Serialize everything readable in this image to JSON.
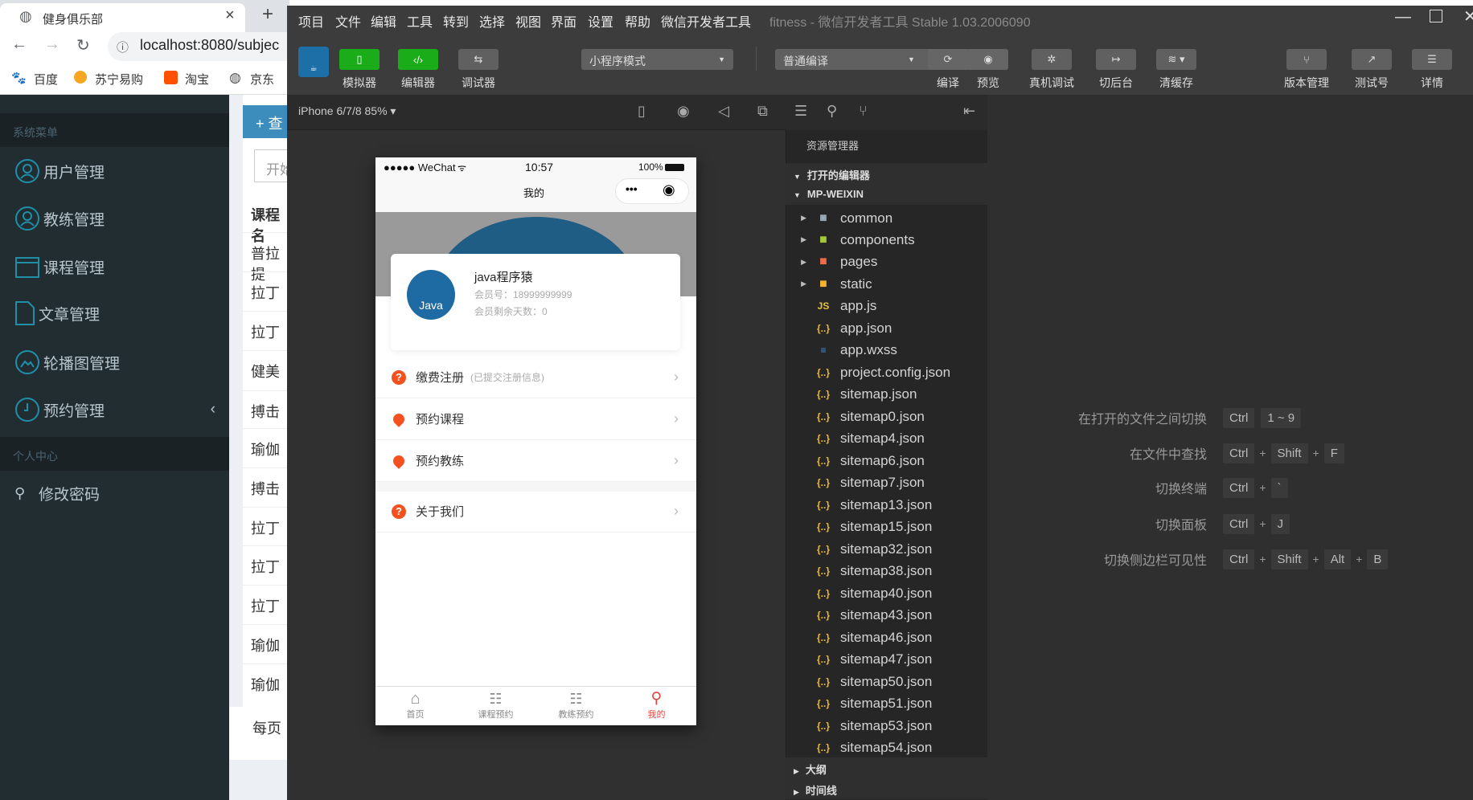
{
  "browser": {
    "tab_title": "健身俱乐部",
    "tab_close": "×",
    "new_tab": "+",
    "url": "localhost:8080/subjec",
    "bookmarks": [
      "百度",
      "苏宁易购",
      "淘宝",
      "京东"
    ]
  },
  "admin": {
    "section_system": "系统菜单",
    "menu": [
      "用户管理",
      "教练管理",
      "课程管理",
      "文章管理",
      "轮播图管理",
      "预约管理"
    ],
    "section_personal": "个人中心",
    "change_password": "修改密码",
    "add_button": "+ 查",
    "date_placeholder": "开始",
    "column_header": "课程名",
    "rows": [
      "普拉提",
      "拉丁",
      "拉丁",
      "健美",
      "搏击",
      "瑜伽",
      "搏击",
      "拉丁",
      "拉丁",
      "拉丁",
      "瑜伽",
      "瑜伽"
    ],
    "per_page": "每页"
  },
  "devtools": {
    "menu": [
      "项目",
      "文件",
      "编辑",
      "工具",
      "转到",
      "选择",
      "视图",
      "界面",
      "设置",
      "帮助",
      "微信开发者工具"
    ],
    "window_title": "fitness - 微信开发者工具 Stable 1.03.2006090",
    "toolbar": {
      "simulator": "模拟器",
      "editor": "编辑器",
      "debugger": "调试器",
      "mode": "小程序模式",
      "compile_mode": "普通编译",
      "compile": "编译",
      "preview": "预览",
      "remote_debug": "真机调试",
      "background": "切后台",
      "clear_cache": "清缓存",
      "version": "版本管理",
      "test_account": "测试号",
      "details": "详情"
    },
    "device": "iPhone 6/7/8 85% ▾"
  },
  "phone": {
    "signal": "●●●●● WeChat",
    "time": "10:57",
    "battery": "100%",
    "nav_title": "我的",
    "user_name": "java程序猿",
    "member_no": "会员号：18999999999",
    "days_left": "会员剩余天数：0",
    "avatar_text": "Java",
    "menu": [
      {
        "label": "缴费注册",
        "note": "(已提交注册信息)",
        "icon": "question"
      },
      {
        "label": "预约课程",
        "note": "",
        "icon": "pin"
      },
      {
        "label": "预约教练",
        "note": "",
        "icon": "pin"
      },
      {
        "label": "关于我们",
        "note": "",
        "icon": "question"
      }
    ],
    "tabs": [
      "首页",
      "课程预约",
      "教练预约",
      "我的"
    ],
    "active_tab_color": "#e64340"
  },
  "explorer": {
    "title": "资源管理器",
    "open_editors": "打开的编辑器",
    "root": "MP-WEIXIN",
    "folders": [
      "common",
      "components",
      "pages",
      "static"
    ],
    "files": [
      "app.js",
      "app.json",
      "app.wxss",
      "project.config.json",
      "sitemap.json",
      "sitemap0.json",
      "sitemap4.json",
      "sitemap6.json",
      "sitemap7.json",
      "sitemap13.json",
      "sitemap15.json",
      "sitemap32.json",
      "sitemap38.json",
      "sitemap40.json",
      "sitemap43.json",
      "sitemap46.json",
      "sitemap47.json",
      "sitemap50.json",
      "sitemap51.json",
      "sitemap53.json",
      "sitemap54.json"
    ],
    "outline": "大纲",
    "timeline": "时间线"
  },
  "shortcuts": [
    {
      "label": "在打开的文件之间切换",
      "keys": [
        "Ctrl",
        "1 ~ 9"
      ],
      "joined": false
    },
    {
      "label": "在文件中查找",
      "keys": [
        "Ctrl",
        "Shift",
        "F"
      ],
      "joined": true
    },
    {
      "label": "切换终端",
      "keys": [
        "Ctrl",
        "`"
      ],
      "joined": true
    },
    {
      "label": "切换面板",
      "keys": [
        "Ctrl",
        "J"
      ],
      "joined": true
    },
    {
      "label": "切换侧边栏可见性",
      "keys": [
        "Ctrl",
        "Shift",
        "Alt",
        "B"
      ],
      "joined": true
    }
  ]
}
